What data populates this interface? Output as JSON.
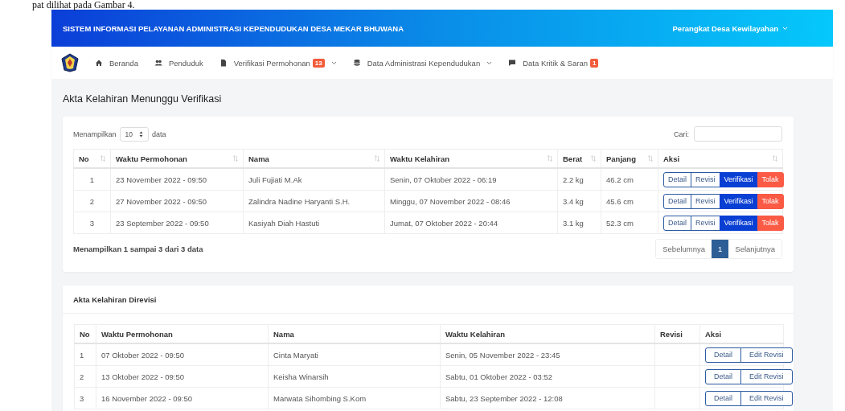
{
  "caption": "pat dilihat pada Gambar 4.",
  "header": {
    "title": "SISTEM INFORMASI PELAYANAN ADMINISTRASI KEPENDUDUKAN DESA MEKAR BHUWANA",
    "user_menu": "Perangkat Desa Kewilayahan"
  },
  "nav": {
    "items": [
      {
        "kind": "home",
        "label": "Beranda",
        "dropdown": false
      },
      {
        "kind": "users",
        "label": "Penduduk",
        "dropdown": false
      },
      {
        "kind": "file",
        "label": "Verifikasi Permohonan",
        "badge": "13",
        "dropdown": true
      },
      {
        "kind": "database",
        "label": "Data Administrasi Kependudukan",
        "dropdown": true
      },
      {
        "kind": "chat",
        "label": "Data Kritik & Saran",
        "badge": "1",
        "dropdown": false
      }
    ]
  },
  "page_title": "Akta Kelahiran Menunggu Verifikasi",
  "verification_table": {
    "length_before": "Menampilkan",
    "length_value": "10",
    "length_after": "data",
    "search_label": "Cari:",
    "columns": [
      {
        "label": "No",
        "sortable": true
      },
      {
        "label": "Waktu Permohonan",
        "sortable": true
      },
      {
        "label": "Nama",
        "sortable": true
      },
      {
        "label": "Waktu Kelahiran",
        "sortable": true
      },
      {
        "label": "Berat",
        "sortable": true
      },
      {
        "label": "Panjang",
        "sortable": true
      },
      {
        "label": "Aksi",
        "sortable": true
      }
    ],
    "rows": [
      {
        "cells": [
          "1",
          "23 November 2022 - 09:50",
          "Juli Fujiati M.Ak",
          "Senin, 07 Oktober 2022 - 06:19",
          "2.2 kg",
          "46.2 cm"
        ],
        "actions": [
          {
            "label": "Detail",
            "kind": "outline"
          },
          {
            "label": "Revisi",
            "kind": "outline"
          },
          {
            "label": "Verifikasi",
            "kind": "primary"
          },
          {
            "label": "Tolak",
            "kind": "danger"
          }
        ]
      },
      {
        "cells": [
          "2",
          "27 November 2022 - 09:50",
          "Zalindra Nadine Haryanti S.H.",
          "Minggu, 07 November 2022 - 08:46",
          "3.4 kg",
          "45.6 cm"
        ],
        "actions": [
          {
            "label": "Detail",
            "kind": "outline"
          },
          {
            "label": "Revisi",
            "kind": "outline"
          },
          {
            "label": "Verifikasi",
            "kind": "primary"
          },
          {
            "label": "Tolak",
            "kind": "danger"
          }
        ]
      },
      {
        "cells": [
          "3",
          "23 September 2022 - 09:50",
          "Kasiyah Diah Hastuti",
          "Jumat, 07 Oktober 2022 - 20:44",
          "3.1 kg",
          "52.3 cm"
        ],
        "actions": [
          {
            "label": "Detail",
            "kind": "outline"
          },
          {
            "label": "Revisi",
            "kind": "outline"
          },
          {
            "label": "Verifikasi",
            "kind": "primary"
          },
          {
            "label": "Tolak",
            "kind": "danger"
          }
        ]
      }
    ],
    "info": "Menampilkan 1 sampai 3 dari 3 data",
    "pagination": [
      {
        "label": "Sebelumnya",
        "selected": false
      },
      {
        "label": "1",
        "selected": true
      },
      {
        "label": "Selanjutnya",
        "selected": false
      }
    ]
  },
  "revised_table": {
    "title": "Akta Kelahiran Direvisi",
    "columns": [
      {
        "label": "No",
        "sortable": false
      },
      {
        "label": "Waktu Permohonan",
        "sortable": false
      },
      {
        "label": "Nama",
        "sortable": false
      },
      {
        "label": "Waktu Kelahiran",
        "sortable": false
      },
      {
        "label": "Revisi",
        "sortable": false
      },
      {
        "label": "Aksi",
        "sortable": false
      }
    ],
    "rows": [
      {
        "cells": [
          "1",
          "07 Oktober 2022 - 09:50",
          "Cinta Maryati",
          "Senin, 05 November 2022 - 23:45",
          ""
        ],
        "actions": [
          {
            "label": "Detail",
            "kind": "outline"
          },
          {
            "label": "Edit Revisi",
            "kind": "outline"
          }
        ]
      },
      {
        "cells": [
          "2",
          "13 Oktober 2022 - 09:50",
          "Keisha Winarsih",
          "Sabtu, 01 Oktober 2022 - 03:52",
          ""
        ],
        "actions": [
          {
            "label": "Detail",
            "kind": "outline"
          },
          {
            "label": "Edit Revisi",
            "kind": "outline"
          }
        ]
      },
      {
        "cells": [
          "3",
          "16 November 2022 - 09:50",
          "Marwata Sihombing S.Kom",
          "Sabtu, 23 September 2022 - 12:08",
          ""
        ],
        "actions": [
          {
            "label": "Detail",
            "kind": "outline"
          },
          {
            "label": "Edit Revisi",
            "kind": "outline"
          }
        ]
      }
    ]
  }
}
